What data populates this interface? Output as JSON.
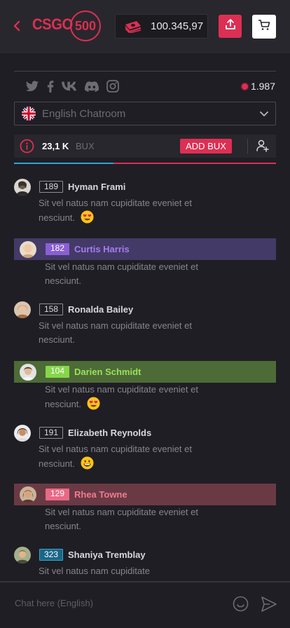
{
  "header": {
    "brand_text": "CSGO",
    "brand_number": "500",
    "balance": "100.345,97",
    "icons": {
      "back": "chevron-left-icon",
      "money": "money-stack-icon",
      "share": "upload-icon",
      "cart": "cart-icon"
    },
    "accent_color": "#dd2f53"
  },
  "social": {
    "icons": [
      "twitter-icon",
      "facebook-icon",
      "vk-icon",
      "discord-icon",
      "instagram-icon"
    ],
    "online_count": "1.987"
  },
  "chatroom": {
    "selected": "English Chatroom",
    "flag": "uk-flag-icon"
  },
  "bux": {
    "count": "23,1 K",
    "unit": "BUX",
    "add_label": "ADD BUX",
    "progress": 0.38
  },
  "messages": [
    {
      "level": "189",
      "name": "Hyman Frami",
      "text": "Sit vel natus nam cupiditate eveniet et nesciunt.",
      "emoji": "heart-eyes",
      "highlight": null
    },
    {
      "level": "182",
      "name": "Curtis Harris",
      "text": "Sit vel natus nam cupiditate eveniet et nesciunt.",
      "emoji": null,
      "highlight": "purple"
    },
    {
      "level": "158",
      "name": "Ronalda Bailey",
      "text": "Sit vel natus nam cupiditate eveniet et nesciunt.",
      "emoji": null,
      "highlight": null
    },
    {
      "level": "104",
      "name": "Darien Schmidt",
      "text": "Sit vel natus nam cupiditate eveniet et nesciunt.",
      "emoji": "heart-eyes",
      "highlight": "green"
    },
    {
      "level": "191",
      "name": "Elizabeth Reynolds",
      "text": "Sit vel natus nam cupiditate eveniet et nesciunt.",
      "emoji": "grin",
      "highlight": null
    },
    {
      "level": "129",
      "name": "Rhea Towne",
      "text": "Sit vel natus nam cupiditate eveniet et nesciunt.",
      "emoji": null,
      "highlight": "red"
    },
    {
      "level": "323",
      "name": "Shaniya Tremblay",
      "text": "Sit vel natus nam cupiditate",
      "emoji": null,
      "highlight": null
    }
  ],
  "input": {
    "placeholder": "Chat here (English)"
  }
}
